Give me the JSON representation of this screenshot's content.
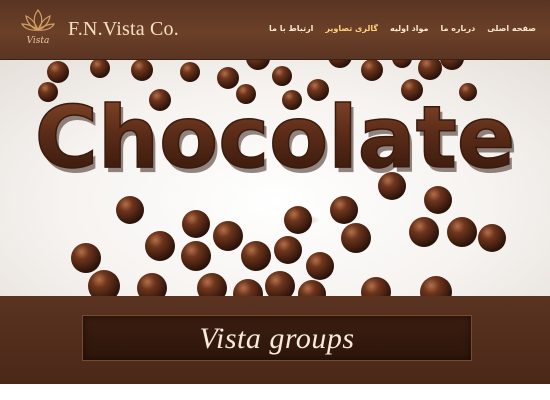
{
  "header": {
    "logo_text": "Vista",
    "brand": "F.N.Vista Co.",
    "nav": [
      {
        "label": "صفحه اصلی",
        "id": "home"
      },
      {
        "label": "درباره ما",
        "id": "about"
      },
      {
        "label": "مواد اولیه",
        "id": "materials"
      },
      {
        "label": "گالری تصاویر",
        "id": "gallery"
      },
      {
        "label": "ارتباط با ما",
        "id": "contact"
      }
    ],
    "active_nav": "gallery"
  },
  "hero": {
    "headline": "Chocolate"
  },
  "caption": {
    "text": "Vista groups"
  },
  "colors": {
    "header_brown": "#6b4029",
    "footer_brown": "#4a2818",
    "caption_box": "#2e160b",
    "chocolate": "#5b2c18",
    "nav_text": "#fbe8cf",
    "active_nav": "#ffd27a"
  }
}
